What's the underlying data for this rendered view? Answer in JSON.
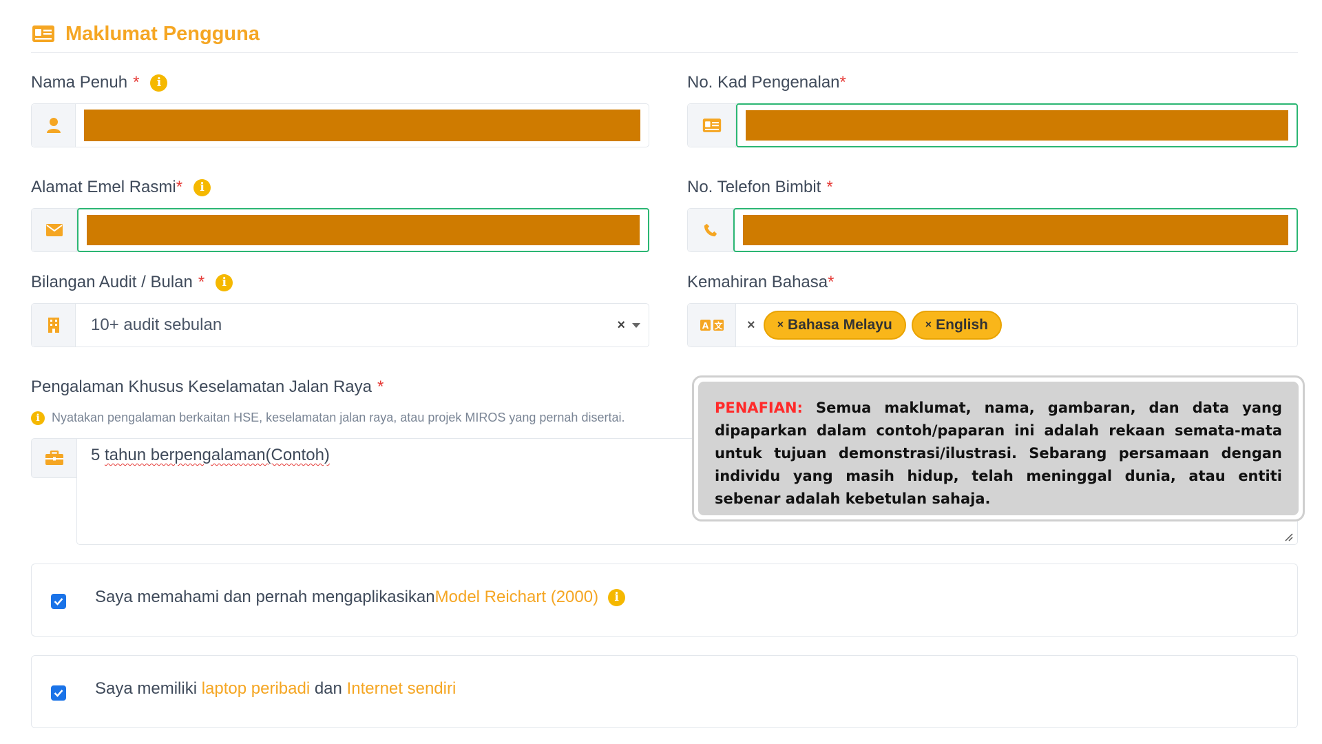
{
  "section": {
    "title": "Maklumat Pengguna"
  },
  "fields": {
    "nama_penuh": {
      "label": "Nama Penuh",
      "required_mark": "*"
    },
    "kad_pengenalan": {
      "label": "No. Kad Pengenalan",
      "required_mark": "*"
    },
    "emel": {
      "label": "Alamat Emel Rasmi",
      "required_mark": "*"
    },
    "telefon": {
      "label": "No. Telefon Bimbit",
      "required_mark": "*"
    },
    "audit": {
      "label": "Bilangan Audit / Bulan",
      "required_mark": "*",
      "value": "10+ audit sebulan",
      "clear": "×"
    },
    "bahasa": {
      "label": "Kemahiran Bahasa",
      "required_mark": "*",
      "clear": "×",
      "tags": [
        "Bahasa Melayu",
        "English"
      ],
      "tag_remove": "×"
    },
    "pengalaman": {
      "label": "Pengalaman Khusus Keselamatan Jalan Raya",
      "required_mark": "*",
      "hint": "Nyatakan pengalaman berkaitan HSE, keselamatan jalan raya, atau projek MIROS yang pernah disertai.",
      "value_prefix": "5 ",
      "value_misspelled": "tahun berpengalaman(Contoh)"
    }
  },
  "info_glyph": "i",
  "disclaimer": {
    "label": "PENAFIAN:",
    "text": "Semua maklumat, nama, gambaran, dan data yang dipaparkan dalam contoh/paparan ini adalah rekaan semata-mata untuk tujuan demonstrasi/ilustrasi. Sebarang persamaan dengan individu yang masih hidup, telah meninggal dunia, atau entiti sebenar adalah kebetulan sahaja."
  },
  "checkboxes": {
    "reichart": {
      "text": "Saya memahami dan pernah mengaplikasikan ",
      "highlight": "Model Reichart (2000)",
      "checked": true
    },
    "laptop": {
      "text1": "Saya memiliki ",
      "hl1": "laptop peribadi",
      "text2": " dan ",
      "hl2": "Internet sendiri",
      "checked": true
    }
  },
  "colors": {
    "accent": "#f5a623",
    "required": "#e53935",
    "valid": "#2bb673",
    "checkbox": "#1a73e8",
    "redaction": "#cf7b00"
  },
  "icons": [
    "id-card-icon",
    "user-icon",
    "envelope-icon",
    "phone-icon",
    "building-icon",
    "translate-icon",
    "briefcase-icon",
    "info-icon",
    "check-icon"
  ]
}
